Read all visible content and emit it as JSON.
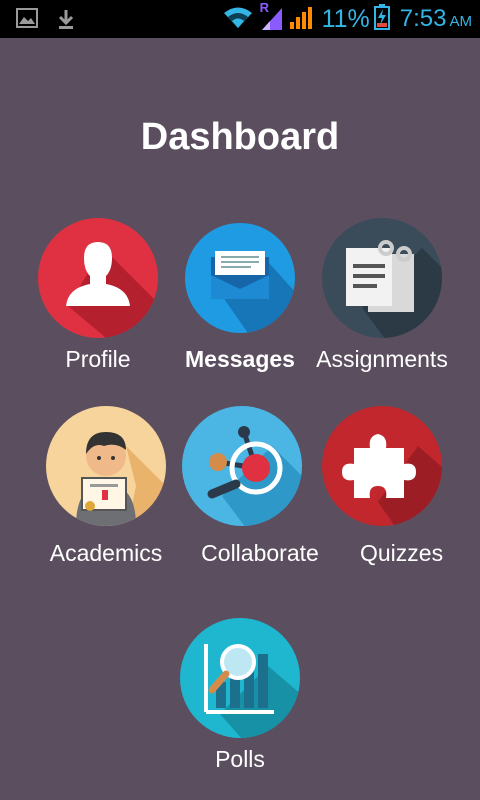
{
  "status_bar": {
    "network_badge": "R",
    "battery_percent": "11%",
    "time": "7:53",
    "ampm": "AM",
    "icons": [
      "picture-icon",
      "download-icon",
      "wifi-icon",
      "signal-icon",
      "battery-charging-icon"
    ]
  },
  "dashboard": {
    "title": "Dashboard",
    "items": [
      {
        "label": "Profile",
        "icon": "person-icon",
        "color": "#e03142"
      },
      {
        "label": "Messages",
        "icon": "envelope-icon",
        "color": "#1e9be3",
        "selected": true
      },
      {
        "label": "Assignments",
        "icon": "clipboard-icon",
        "color": "#3a4b5a"
      },
      {
        "label": "Academics",
        "icon": "student-certificate-icon",
        "color": "#f7d49b"
      },
      {
        "label": "Collaborate",
        "icon": "molecule-icon",
        "color": "#4bb6e3"
      },
      {
        "label": "Quizzes",
        "icon": "puzzle-icon",
        "color": "#c1272d"
      },
      {
        "label": "Polls",
        "icon": "chart-magnifier-icon",
        "color": "#1fb7d0"
      }
    ]
  }
}
